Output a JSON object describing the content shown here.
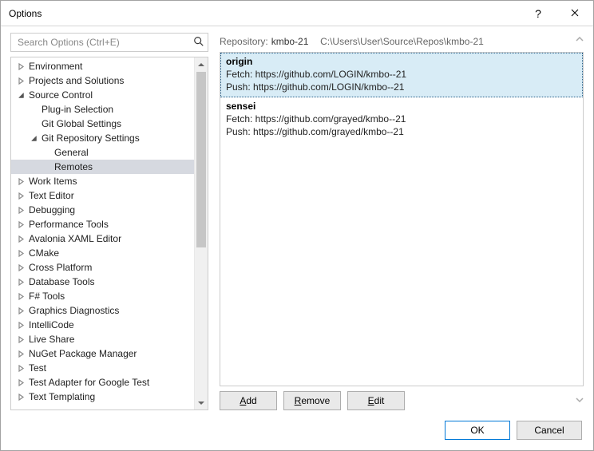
{
  "window": {
    "title": "Options"
  },
  "search": {
    "placeholder": "Search Options (Ctrl+E)"
  },
  "tree": {
    "items": [
      {
        "label": "Environment",
        "depth": 0,
        "twisty": "collapsed"
      },
      {
        "label": "Projects and Solutions",
        "depth": 0,
        "twisty": "collapsed"
      },
      {
        "label": "Source Control",
        "depth": 0,
        "twisty": "expanded"
      },
      {
        "label": "Plug-in Selection",
        "depth": 1,
        "twisty": "none"
      },
      {
        "label": "Git Global Settings",
        "depth": 1,
        "twisty": "none"
      },
      {
        "label": "Git Repository Settings",
        "depth": 1,
        "twisty": "expanded"
      },
      {
        "label": "General",
        "depth": 2,
        "twisty": "none"
      },
      {
        "label": "Remotes",
        "depth": 2,
        "twisty": "none",
        "selected": true
      },
      {
        "label": "Work Items",
        "depth": 0,
        "twisty": "collapsed"
      },
      {
        "label": "Text Editor",
        "depth": 0,
        "twisty": "collapsed"
      },
      {
        "label": "Debugging",
        "depth": 0,
        "twisty": "collapsed"
      },
      {
        "label": "Performance Tools",
        "depth": 0,
        "twisty": "collapsed"
      },
      {
        "label": "Avalonia XAML Editor",
        "depth": 0,
        "twisty": "collapsed"
      },
      {
        "label": "CMake",
        "depth": 0,
        "twisty": "collapsed"
      },
      {
        "label": "Cross Platform",
        "depth": 0,
        "twisty": "collapsed"
      },
      {
        "label": "Database Tools",
        "depth": 0,
        "twisty": "collapsed"
      },
      {
        "label": "F# Tools",
        "depth": 0,
        "twisty": "collapsed"
      },
      {
        "label": "Graphics Diagnostics",
        "depth": 0,
        "twisty": "collapsed"
      },
      {
        "label": "IntelliCode",
        "depth": 0,
        "twisty": "collapsed"
      },
      {
        "label": "Live Share",
        "depth": 0,
        "twisty": "collapsed"
      },
      {
        "label": "NuGet Package Manager",
        "depth": 0,
        "twisty": "collapsed"
      },
      {
        "label": "Test",
        "depth": 0,
        "twisty": "collapsed"
      },
      {
        "label": "Test Adapter for Google Test",
        "depth": 0,
        "twisty": "collapsed"
      },
      {
        "label": "Text Templating",
        "depth": 0,
        "twisty": "collapsed"
      }
    ]
  },
  "repo": {
    "label": "Repository:",
    "name": "kmbo-21",
    "path": "C:\\Users\\User\\Source\\Repos\\kmbo-21"
  },
  "remotes": [
    {
      "name": "origin",
      "fetch_label": "Fetch:",
      "fetch": "https://github.com/LOGIN/kmbo--21",
      "push_label": "Push:",
      "push": "https://github.com/LOGIN/kmbo--21",
      "selected": true
    },
    {
      "name": "sensei",
      "fetch_label": "Fetch:",
      "fetch": "https://github.com/grayed/kmbo--21",
      "push_label": "Push:",
      "push": "https://github.com/grayed/kmbo--21",
      "selected": false
    }
  ],
  "buttons": {
    "add_u": "A",
    "add_rest": "dd",
    "remove_u": "R",
    "remove_rest": "emove",
    "edit_u": "E",
    "edit_rest": "dit",
    "ok": "OK",
    "cancel": "Cancel"
  }
}
